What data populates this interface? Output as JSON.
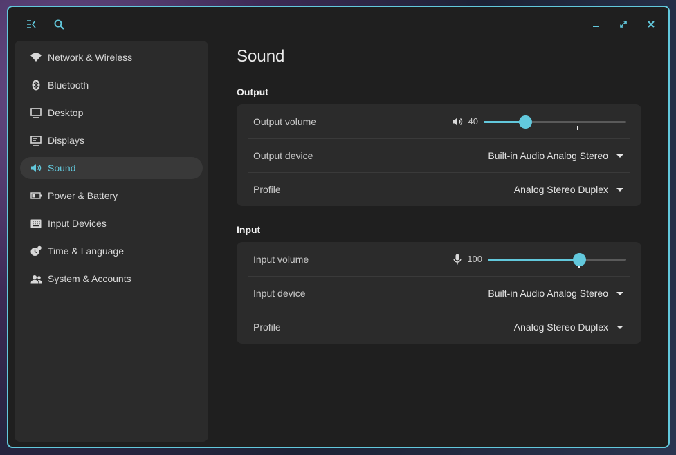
{
  "titlebar": {
    "menu_icon": "sidebar-toggle-icon",
    "search_icon": "search-icon",
    "minimize_icon": "minimize-icon",
    "maximize_icon": "maximize-icon",
    "close_icon": "close-icon"
  },
  "sidebar": {
    "items": [
      {
        "label": "Network & Wireless",
        "icon": "wifi-icon"
      },
      {
        "label": "Bluetooth",
        "icon": "bluetooth-icon"
      },
      {
        "label": "Desktop",
        "icon": "monitor-icon"
      },
      {
        "label": "Displays",
        "icon": "display-icon"
      },
      {
        "label": "Sound",
        "icon": "speaker-icon",
        "active": true
      },
      {
        "label": "Power & Battery",
        "icon": "battery-icon"
      },
      {
        "label": "Input Devices",
        "icon": "keyboard-icon"
      },
      {
        "label": "Time & Language",
        "icon": "clock-icon"
      },
      {
        "label": "System & Accounts",
        "icon": "users-icon"
      }
    ]
  },
  "main": {
    "title": "Sound",
    "output": {
      "heading": "Output",
      "volume_label": "Output volume",
      "volume_value": "40",
      "volume_fraction": 0.29,
      "volume_mark_fraction": 0.66,
      "device_label": "Output device",
      "device_value": "Built-in Audio Analog Stereo",
      "profile_label": "Profile",
      "profile_value": "Analog Stereo Duplex"
    },
    "input": {
      "heading": "Input",
      "volume_label": "Input volume",
      "volume_value": "100",
      "volume_fraction": 0.66,
      "volume_mark_fraction": 0.66,
      "device_label": "Input device",
      "device_value": "Built-in Audio Analog Stereo",
      "profile_label": "Profile",
      "profile_value": "Analog Stereo Duplex"
    }
  },
  "colors": {
    "accent": "#62c8dc",
    "background": "#1f1f1f",
    "card": "#2b2b2b"
  }
}
